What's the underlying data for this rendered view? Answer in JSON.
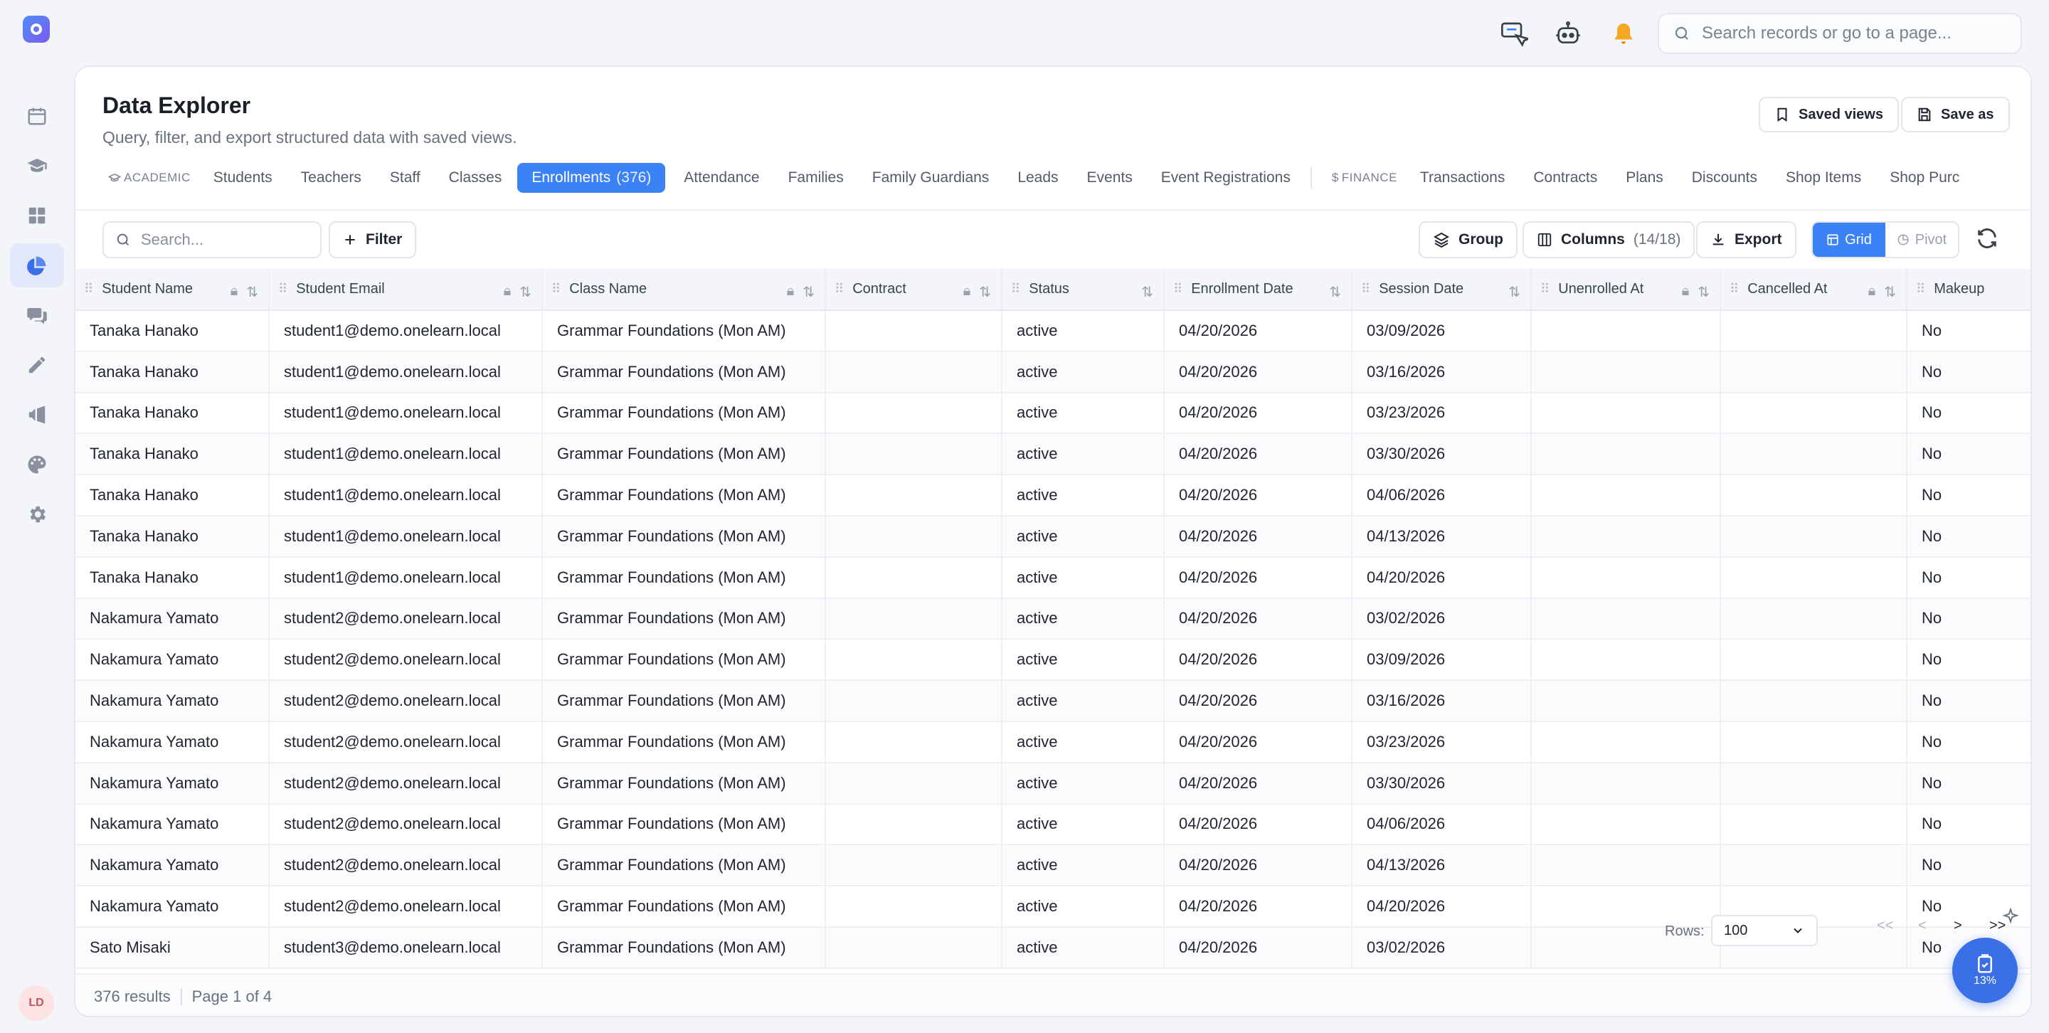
{
  "topbar": {
    "search_placeholder": "Search records or go to a page..."
  },
  "user": {
    "initials": "LD"
  },
  "page": {
    "title": "Data Explorer",
    "subtitle": "Query, filter, and export structured data with saved views.",
    "saved_views_label": "Saved views",
    "save_as_label": "Save as"
  },
  "tabs": {
    "academic_group": "ACADEMIC",
    "finance_group": "FINANCE",
    "academic": [
      "Students",
      "Teachers",
      "Staff",
      "Classes"
    ],
    "active": {
      "label": "Enrollments",
      "count": "(376)"
    },
    "academic_after": [
      "Attendance",
      "Families",
      "Family Guardians",
      "Leads",
      "Events",
      "Event Registrations"
    ],
    "finance": [
      "Transactions",
      "Contracts",
      "Plans",
      "Discounts",
      "Shop Items",
      "Shop Purc"
    ]
  },
  "toolbar": {
    "search_placeholder": "Search...",
    "filter_label": "Filter",
    "group_label": "Group",
    "columns_label": "Columns",
    "columns_count": "(14/18)",
    "export_label": "Export",
    "grid_label": "Grid",
    "pivot_label": "Pivot"
  },
  "table": {
    "columns": [
      "Student Name",
      "Student Email",
      "Class Name",
      "Contract",
      "Status",
      "Enrollment Date",
      "Session Date",
      "Unenrolled At",
      "Cancelled At",
      "Makeup"
    ],
    "rows": [
      [
        "Tanaka Hanako",
        "student1@demo.onelearn.local",
        "Grammar Foundations (Mon AM)",
        "",
        "active",
        "04/20/2026",
        "03/09/2026",
        "",
        "",
        "No"
      ],
      [
        "Tanaka Hanako",
        "student1@demo.onelearn.local",
        "Grammar Foundations (Mon AM)",
        "",
        "active",
        "04/20/2026",
        "03/16/2026",
        "",
        "",
        "No"
      ],
      [
        "Tanaka Hanako",
        "student1@demo.onelearn.local",
        "Grammar Foundations (Mon AM)",
        "",
        "active",
        "04/20/2026",
        "03/23/2026",
        "",
        "",
        "No"
      ],
      [
        "Tanaka Hanako",
        "student1@demo.onelearn.local",
        "Grammar Foundations (Mon AM)",
        "",
        "active",
        "04/20/2026",
        "03/30/2026",
        "",
        "",
        "No"
      ],
      [
        "Tanaka Hanako",
        "student1@demo.onelearn.local",
        "Grammar Foundations (Mon AM)",
        "",
        "active",
        "04/20/2026",
        "04/06/2026",
        "",
        "",
        "No"
      ],
      [
        "Tanaka Hanako",
        "student1@demo.onelearn.local",
        "Grammar Foundations (Mon AM)",
        "",
        "active",
        "04/20/2026",
        "04/13/2026",
        "",
        "",
        "No"
      ],
      [
        "Tanaka Hanako",
        "student1@demo.onelearn.local",
        "Grammar Foundations (Mon AM)",
        "",
        "active",
        "04/20/2026",
        "04/20/2026",
        "",
        "",
        "No"
      ],
      [
        "Nakamura Yamato",
        "student2@demo.onelearn.local",
        "Grammar Foundations (Mon AM)",
        "",
        "active",
        "04/20/2026",
        "03/02/2026",
        "",
        "",
        "No"
      ],
      [
        "Nakamura Yamato",
        "student2@demo.onelearn.local",
        "Grammar Foundations (Mon AM)",
        "",
        "active",
        "04/20/2026",
        "03/09/2026",
        "",
        "",
        "No"
      ],
      [
        "Nakamura Yamato",
        "student2@demo.onelearn.local",
        "Grammar Foundations (Mon AM)",
        "",
        "active",
        "04/20/2026",
        "03/16/2026",
        "",
        "",
        "No"
      ],
      [
        "Nakamura Yamato",
        "student2@demo.onelearn.local",
        "Grammar Foundations (Mon AM)",
        "",
        "active",
        "04/20/2026",
        "03/23/2026",
        "",
        "",
        "No"
      ],
      [
        "Nakamura Yamato",
        "student2@demo.onelearn.local",
        "Grammar Foundations (Mon AM)",
        "",
        "active",
        "04/20/2026",
        "03/30/2026",
        "",
        "",
        "No"
      ],
      [
        "Nakamura Yamato",
        "student2@demo.onelearn.local",
        "Grammar Foundations (Mon AM)",
        "",
        "active",
        "04/20/2026",
        "04/06/2026",
        "",
        "",
        "No"
      ],
      [
        "Nakamura Yamato",
        "student2@demo.onelearn.local",
        "Grammar Foundations (Mon AM)",
        "",
        "active",
        "04/20/2026",
        "04/13/2026",
        "",
        "",
        "No"
      ],
      [
        "Nakamura Yamato",
        "student2@demo.onelearn.local",
        "Grammar Foundations (Mon AM)",
        "",
        "active",
        "04/20/2026",
        "04/20/2026",
        "",
        "",
        "No"
      ],
      [
        "Sato Misaki",
        "student3@demo.onelearn.local",
        "Grammar Foundations (Mon AM)",
        "",
        "active",
        "04/20/2026",
        "03/02/2026",
        "",
        "",
        "No"
      ]
    ]
  },
  "footer": {
    "results": "376 results",
    "page": "Page 1 of 4",
    "rows_label": "Rows:",
    "rows_value": "100"
  },
  "fab": {
    "percent": "13%"
  },
  "colors": {
    "accent": "#3b82f6",
    "fab": "#3b6fe8"
  }
}
